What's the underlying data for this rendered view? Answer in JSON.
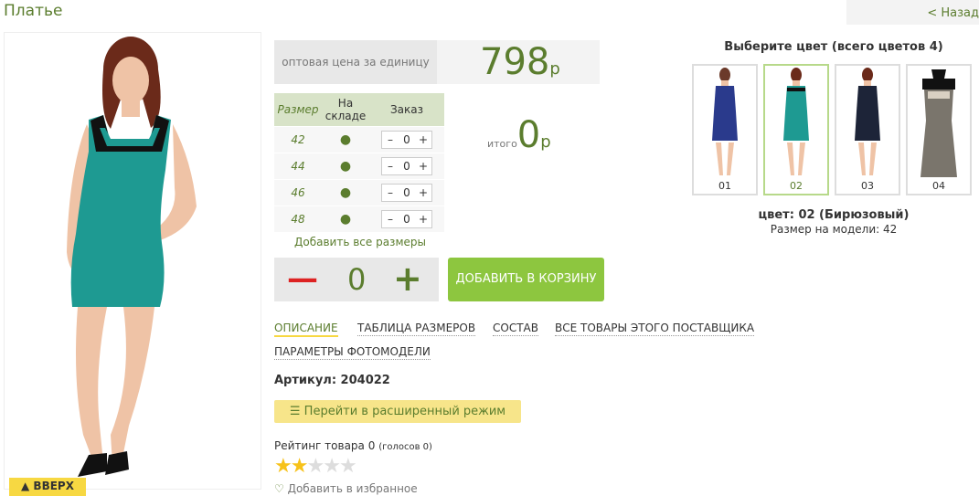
{
  "header": {
    "title": "Платье",
    "back_link": "< Назад"
  },
  "product": {
    "price_label": "оптовая цена за единицу",
    "price_value": "798",
    "price_currency": "р",
    "up_button": "▲ ВВЕРХ"
  },
  "sizes": {
    "headers": [
      "Размер",
      "На складе",
      "Заказ"
    ],
    "rows": [
      {
        "size": "42",
        "stock": "●",
        "qty": "0"
      },
      {
        "size": "44",
        "stock": "●",
        "qty": "0"
      },
      {
        "size": "46",
        "stock": "●",
        "qty": "0"
      },
      {
        "size": "48",
        "stock": "●",
        "qty": "0"
      }
    ],
    "stepper_minus": "–",
    "stepper_plus": "+"
  },
  "total": {
    "label": "итого",
    "value": "0",
    "currency": "р"
  },
  "order": {
    "add_all_sizes": "Добавить все размеры",
    "qty_minus": "—",
    "qty_value": "0",
    "qty_plus": "+",
    "add_to_cart": "ДОБАВИТЬ В КОРЗИНУ"
  },
  "tabs": [
    "ОПИСАНИЕ",
    "ТАБЛИЦА РАЗМЕРОВ",
    "СОСТАВ",
    "ВСЕ ТОВАРЫ ЭТОГО ПОСТАВЩИКА",
    "ПАРАМЕТРЫ ФОТОМОДЕЛИ"
  ],
  "article": "Артикул: 204022",
  "extended_mode": "Перейти в расширенный режим",
  "rating": {
    "text": "Рейтинг товара 0",
    "votes": "(голосов 0)",
    "stars_filled": 2,
    "stars_total": 5
  },
  "favorites": "Добавить в избранное",
  "colors": {
    "title": "Выберите цвет (всего цветов 4)",
    "items": [
      {
        "label": "01",
        "color": "#2a3a8c"
      },
      {
        "label": "02",
        "color": "#1e9a92"
      },
      {
        "label": "03",
        "color": "#1d2438"
      },
      {
        "label": "04",
        "color": "#7a756c"
      }
    ],
    "selected_text": "цвет: 02 (Бирюзовый)",
    "model_size": "Размер на модели: 42"
  },
  "style": {
    "accent": "#5b7d2e",
    "button_green": "#8dc63f",
    "yellow": "#f7d842",
    "dress_color": "#1e9a92"
  }
}
